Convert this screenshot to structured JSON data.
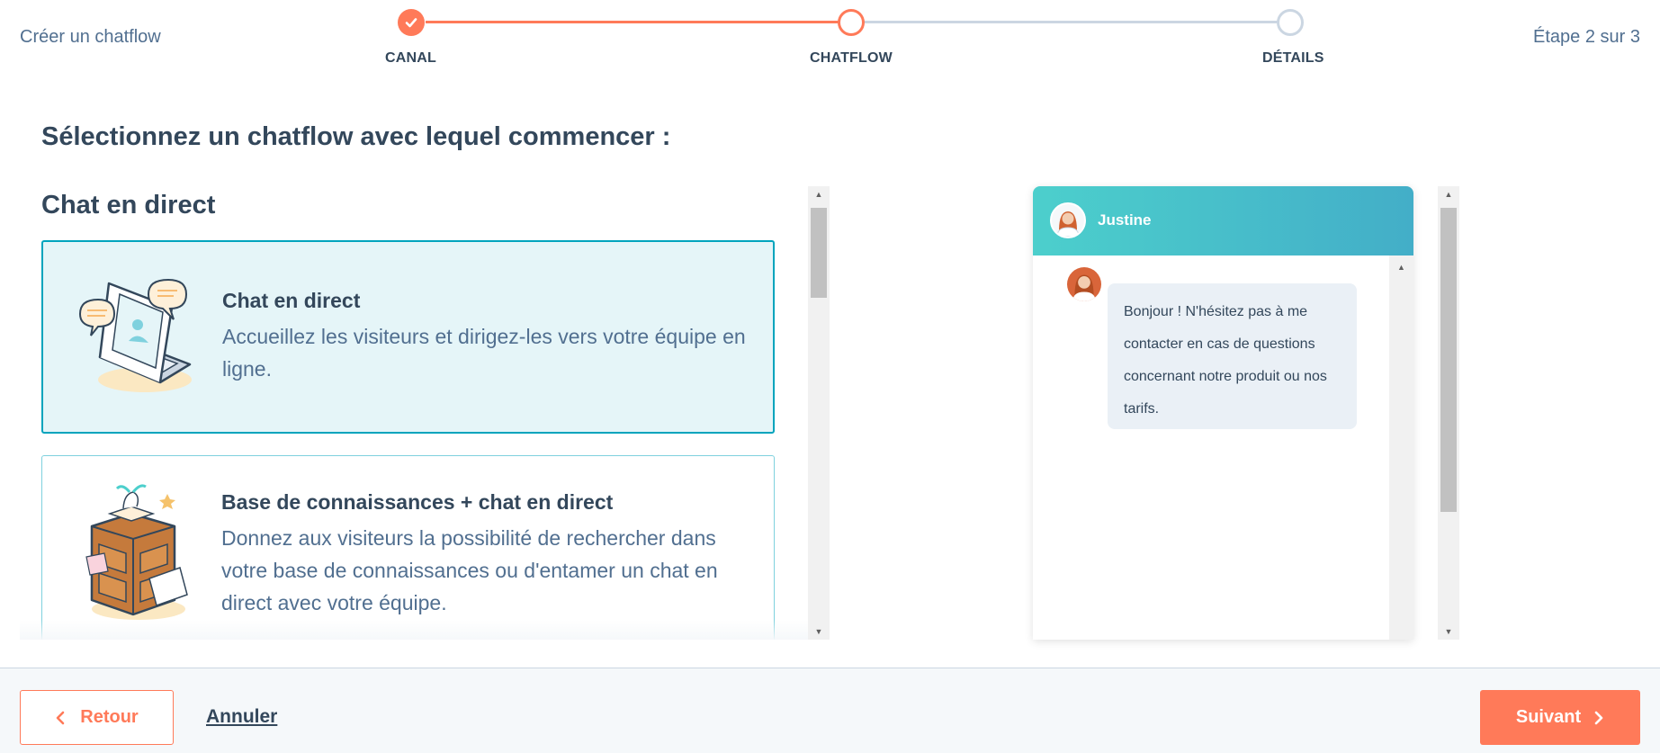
{
  "header": {
    "app_title": "Créer un chatflow",
    "step_count": "Étape 2 sur 3",
    "steps": [
      {
        "label": "CANAL",
        "state": "done"
      },
      {
        "label": "CHATFLOW",
        "state": "active"
      },
      {
        "label": "DÉTAILS",
        "state": "todo"
      }
    ]
  },
  "main": {
    "title": "Sélectionnez un chatflow avec lequel commencer :",
    "section_title": "Chat en direct",
    "cards": [
      {
        "title": "Chat en direct",
        "description": "Accueillez les visiteurs et dirigez-les vers votre équipe en ligne.",
        "selected": true,
        "icon": "laptop-chat-icon"
      },
      {
        "title": "Base de connaissances + chat en direct",
        "description": "Donnez aux visiteurs la possibilité de rechercher dans votre base de connaissances ou d'entamer un chat en direct avec votre équipe.",
        "selected": false,
        "icon": "filing-cabinet-icon"
      }
    ]
  },
  "preview": {
    "agent_name": "Justine",
    "message": "Bonjour ! N'hésitez pas à me contacter en cas de questions concernant notre produit ou nos tarifs."
  },
  "footer": {
    "back_label": "Retour",
    "cancel_label": "Annuler",
    "next_label": "Suivant"
  },
  "colors": {
    "accent": "#ff7a59",
    "teal": "#00a4bd",
    "text": "#33475b",
    "muted": "#516f90"
  }
}
